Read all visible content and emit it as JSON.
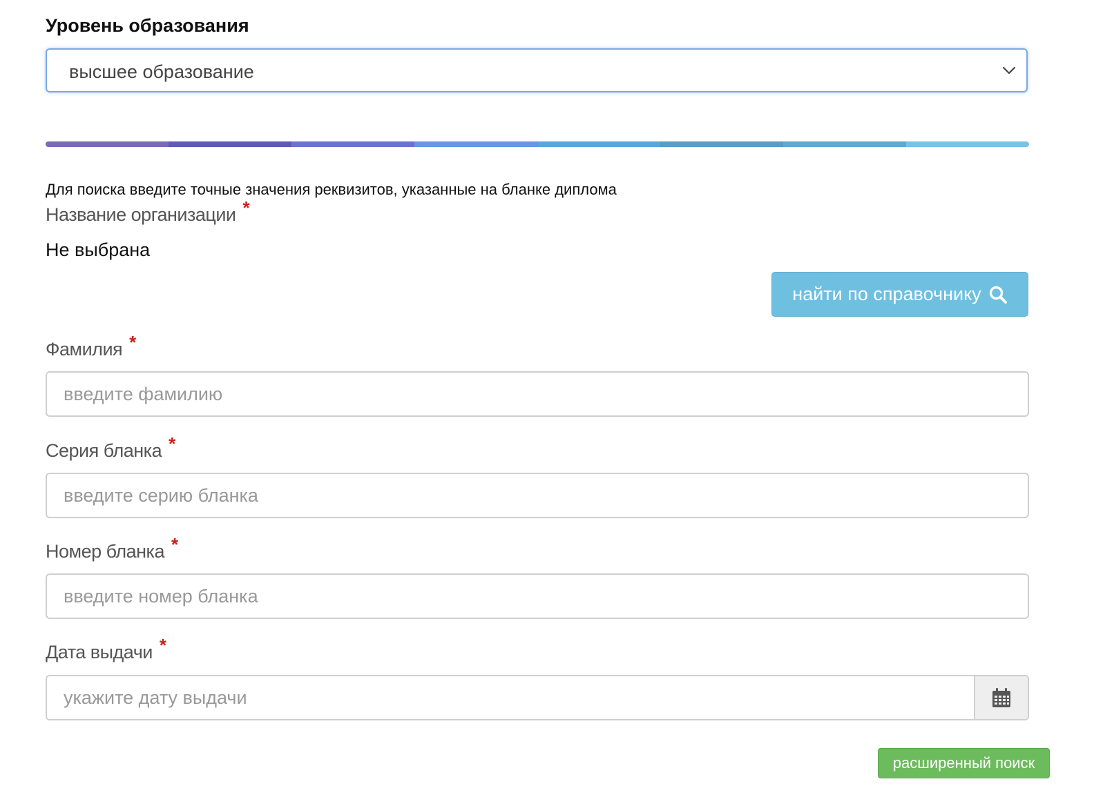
{
  "education_level": {
    "label": "Уровень образования",
    "selected": "высшее образование"
  },
  "progress_colors": [
    "#7b6bb4",
    "#5f5bb2",
    "#6a73cf",
    "#6b95e0",
    "#5da5d6",
    "#5b9cc0",
    "#63a8cc",
    "#7bc2e2"
  ],
  "hint": "Для поиска введите точные значения реквизитов, указанные на бланке диплома",
  "organization": {
    "label": "Название организации",
    "required_mark": "*",
    "value": "Не выбрана",
    "search_button_label": "найти по справочнику"
  },
  "surname": {
    "label": "Фамилия",
    "required_mark": "*",
    "placeholder": "введите фамилию"
  },
  "series": {
    "label": "Серия бланка",
    "required_mark": "*",
    "placeholder": "введите серию бланка"
  },
  "number": {
    "label": "Номер бланка",
    "required_mark": "*",
    "placeholder": "введите номер бланка"
  },
  "issue_date": {
    "label": "Дата выдачи",
    "required_mark": "*",
    "placeholder": "укажите дату выдачи"
  },
  "advanced_search_label": "расширенный поиск"
}
